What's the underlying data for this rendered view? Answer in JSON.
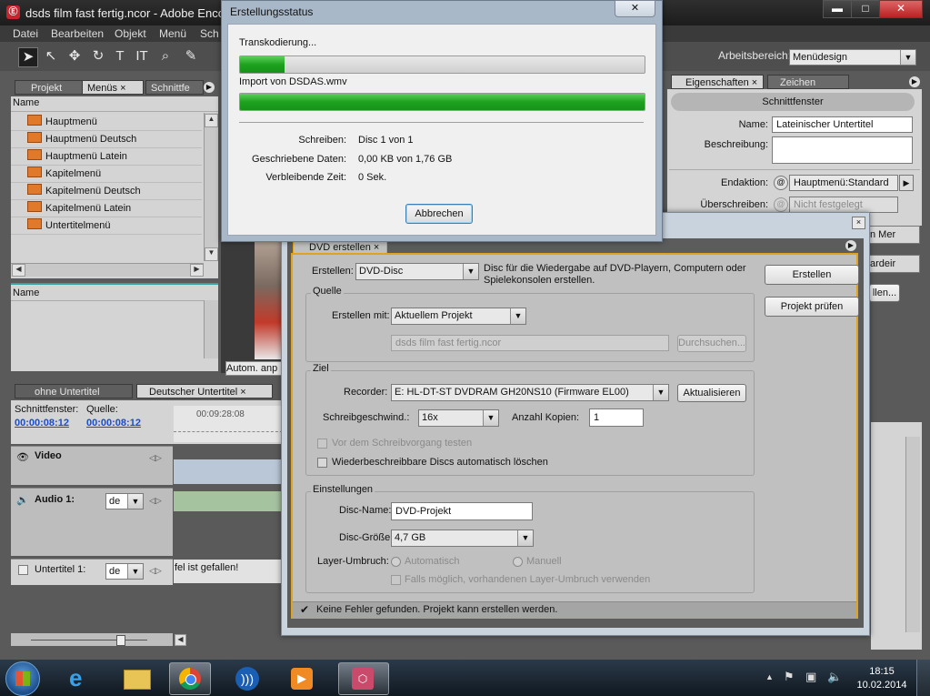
{
  "window": {
    "title": "dsds film fast fertig.ncor - Adobe Encore"
  },
  "menubar": [
    "Datei",
    "Bearbeiten",
    "Objekt",
    "Menü",
    "Sch"
  ],
  "workspace": {
    "label": "Arbeitsbereich:",
    "value": "Menüdesign"
  },
  "left_panel": {
    "tabs": [
      "Projekt",
      "Menüs",
      "Schnittfe"
    ],
    "name_header": "Name",
    "items": [
      "Hauptmenü",
      "Hauptmenü Deutsch",
      "Hauptmenü Latein",
      "Kapitelmenü",
      "Kapitelmenü Deutsch",
      "Kapitelmenü Latein",
      "Untertitelmenü"
    ],
    "second_name_header": "Name"
  },
  "status_dialog": {
    "title": "Erstellungsstatus",
    "stage": "Transkodierung...",
    "stage_progress": 0.11,
    "file": "Import von DSDAS.wmv",
    "file_progress": 1.0,
    "rows": [
      {
        "label": "Schreiben:",
        "value": "Disc 1 von 1"
      },
      {
        "label": "Geschriebene Daten:",
        "value": "0,00 KB von 1,76 GB"
      },
      {
        "label": "Verbleibende Zeit:",
        "value": "0 Sek."
      }
    ],
    "cancel": "Abbrechen"
  },
  "properties": {
    "tabs": [
      "Eigenschaften",
      "Zeichen"
    ],
    "header": "Schnittfenster",
    "name_label": "Name:",
    "name_value": "Lateinischer Untertitel",
    "desc_label": "Beschreibung:",
    "end_label": "Endaktion:",
    "end_value": "Hauptmenü:Standard",
    "override_label": "Überschreiben:",
    "override_value": "Nicht festgelegt",
    "peek1": "n Mer",
    "peek2": "ardeir",
    "peek3": "llen..."
  },
  "dvd_dialog": {
    "tab": "DVD erstellen",
    "create_label": "Erstellen:",
    "create_value": "DVD-Disc",
    "create_desc": "Disc für die Wiedergabe auf DVD-Playern, Computern oder Spielekonsolen erstellen.",
    "btn_create": "Erstellen",
    "btn_check": "Projekt prüfen",
    "source_group": "Quelle",
    "create_with_label": "Erstellen mit:",
    "create_with_value": "Aktuellem Projekt",
    "source_path": "dsds film fast fertig.ncor",
    "browse": "Durchsuchen...",
    "target_group": "Ziel",
    "recorder_label": "Recorder:",
    "recorder_value": "E: HL-DT-ST DVDRAM GH20NS10 (Firmware EL00)",
    "refresh": "Aktualisieren",
    "speed_label": "Schreibgeschwind.:",
    "speed_value": "16x",
    "copies_label": "Anzahl Kopien:",
    "copies_value": "1",
    "test_label": "Vor dem Schreibvorgang testen",
    "erase_label": "Wiederbeschreibbare Discs automatisch löschen",
    "settings_group": "Einstellungen",
    "disc_name_label": "Disc-Name:",
    "disc_name_value": "DVD-Projekt",
    "disc_size_label": "Disc-Größe:",
    "disc_size_value": "4,7 GB",
    "layer_label": "Layer-Umbruch:",
    "layer_auto": "Automatisch",
    "layer_manual": "Manuell",
    "layer_existing": "Falls möglich, vorhandenen Layer-Umbruch verwenden",
    "footer": "Keine Fehler gefunden. Projekt kann erstellen werden."
  },
  "preview": {
    "badge": "Autom. anp"
  },
  "timeline": {
    "tabs": [
      "ohne Untertitel",
      "Deutscher Untertitel"
    ],
    "schnitt_label": "Schnittfenster:",
    "quelle_label": "Quelle:",
    "tc1": "00:00:08:12",
    "tc2": "00:00:08:12",
    "ruler": "00:09:28:08",
    "video": "Video",
    "audio": "Audio 1:",
    "audio_lang": "de",
    "sub": "Untertitel 1:",
    "sub_lang": "de",
    "sub_clip": "fel ist gefallen!"
  },
  "taskbar": {
    "time": "18:15",
    "date": "10.02.2014"
  }
}
